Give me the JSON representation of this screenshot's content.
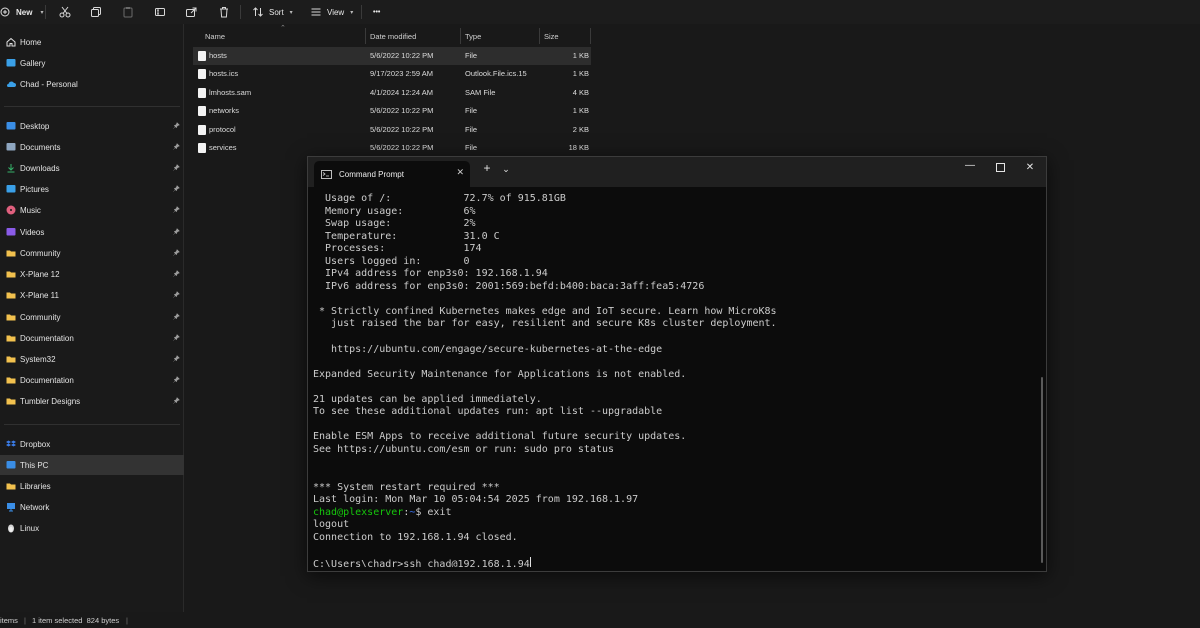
{
  "toolbar": {
    "new_label": "New",
    "sort_label": "Sort",
    "view_label": "View",
    "more_label": "•••"
  },
  "sidebar": {
    "items": [
      {
        "label": "Home",
        "icon": "home-icon",
        "color": "#e0e0e0"
      },
      {
        "label": "Gallery",
        "icon": "gallery-icon",
        "color": "#3aa0e8"
      },
      {
        "label": "Chad - Personal",
        "icon": "cloud-icon",
        "color": "#3aa0e8"
      },
      {
        "label": "Desktop",
        "icon": "desktop-icon",
        "color": "#3a8ee6"
      },
      {
        "label": "Documents",
        "icon": "documents-icon",
        "color": "#8ea6c0"
      },
      {
        "label": "Downloads",
        "icon": "downloads-icon",
        "color": "#35b36a"
      },
      {
        "label": "Pictures",
        "icon": "pictures-icon",
        "color": "#3aa0e8"
      },
      {
        "label": "Music",
        "icon": "music-icon",
        "color": "#e0607e"
      },
      {
        "label": "Videos",
        "icon": "videos-icon",
        "color": "#8a5be8"
      },
      {
        "label": "Community",
        "icon": "folder-icon",
        "color": "#f2c14e"
      },
      {
        "label": "X-Plane 12",
        "icon": "folder-icon",
        "color": "#f2c14e"
      },
      {
        "label": "X-Plane 11",
        "icon": "folder-icon",
        "color": "#f2c14e"
      },
      {
        "label": "Community",
        "icon": "folder-icon",
        "color": "#f2c14e"
      },
      {
        "label": "Documentation",
        "icon": "folder-icon",
        "color": "#f2c14e"
      },
      {
        "label": "System32",
        "icon": "folder-icon",
        "color": "#f2c14e"
      },
      {
        "label": "Documentation",
        "icon": "folder-icon",
        "color": "#f2c14e"
      },
      {
        "label": "Tumbler Designs",
        "icon": "folder-icon",
        "color": "#f2c14e"
      },
      {
        "label": "Dropbox",
        "icon": "dropbox-icon",
        "color": "#3a7ce8"
      },
      {
        "label": "This PC",
        "icon": "pc-icon",
        "color": "#3a8ee6"
      },
      {
        "label": "Libraries",
        "icon": "libraries-icon",
        "color": "#f2c14e"
      },
      {
        "label": "Network",
        "icon": "network-icon",
        "color": "#3a8ee6"
      },
      {
        "label": "Linux",
        "icon": "linux-icon",
        "color": "#d8d8d8"
      }
    ]
  },
  "files": {
    "columns": [
      "Name",
      "Date modified",
      "Type",
      "Size"
    ],
    "rows": [
      {
        "name": "hosts",
        "date": "5/6/2022 10:22 PM",
        "type": "File",
        "size": "1 KB"
      },
      {
        "name": "hosts.ics",
        "date": "9/17/2023 2:59 AM",
        "type": "Outlook.File.ics.15",
        "size": "1 KB"
      },
      {
        "name": "lmhosts.sam",
        "date": "4/1/2024 12:24 AM",
        "type": "SAM File",
        "size": "4 KB"
      },
      {
        "name": "networks",
        "date": "5/6/2022 10:22 PM",
        "type": "File",
        "size": "1 KB"
      },
      {
        "name": "protocol",
        "date": "5/6/2022 10:22 PM",
        "type": "File",
        "size": "2 KB"
      },
      {
        "name": "services",
        "date": "5/6/2022 10:22 PM",
        "type": "File",
        "size": "18 KB"
      }
    ]
  },
  "status": {
    "items": "items",
    "selected": "1 item selected  824 bytes"
  },
  "terminal": {
    "tab_label": "Command Prompt",
    "lines": [
      "  Usage of /:            72.7% of 915.81GB",
      "  Memory usage:          6%",
      "  Swap usage:            2%",
      "  Temperature:           31.0 C",
      "  Processes:             174",
      "  Users logged in:       0",
      "  IPv4 address for enp3s0: 192.168.1.94",
      "  IPv6 address for enp3s0: 2001:569:befd:b400:baca:3aff:fea5:4726",
      "",
      " * Strictly confined Kubernetes makes edge and IoT secure. Learn how MicroK8s",
      "   just raised the bar for easy, resilient and secure K8s cluster deployment.",
      "",
      "   https://ubuntu.com/engage/secure-kubernetes-at-the-edge",
      "",
      "Expanded Security Maintenance for Applications is not enabled.",
      "",
      "21 updates can be applied immediately.",
      "To see these additional updates run: apt list --upgradable",
      "",
      "Enable ESM Apps to receive additional future security updates.",
      "See https://ubuntu.com/esm or run: sudo pro status",
      "",
      "",
      "*** System restart required ***",
      "Last login: Mon Mar 10 05:04:54 2025 from 192.168.1.97"
    ],
    "prompt_user": "chad@plexserver",
    "prompt_sep": ":",
    "prompt_path": "~",
    "prompt_cmd": "$ exit",
    "after_lines": [
      "logout",
      "Connection to 192.168.1.94 closed.",
      ""
    ],
    "current_prompt": "C:\\Users\\chadr>ssh chad@192.168.1.94"
  }
}
